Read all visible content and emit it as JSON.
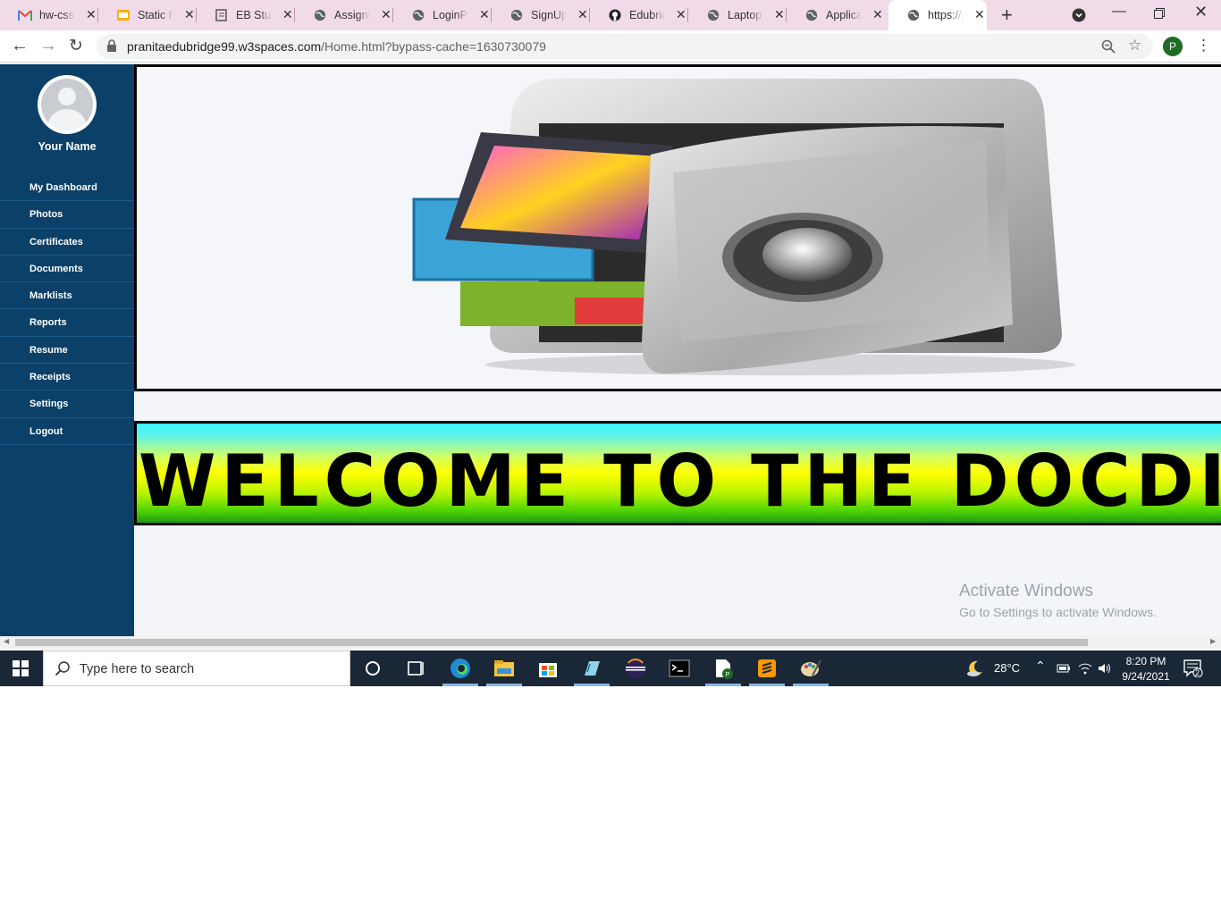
{
  "browser": {
    "tabs": [
      {
        "title": "hw-css-f",
        "icon": "gmail-icon"
      },
      {
        "title": "Static Pr",
        "icon": "slides-icon"
      },
      {
        "title": "EB Stude",
        "icon": "book-icon"
      },
      {
        "title": "Assignm",
        "icon": "globe-icon"
      },
      {
        "title": "LoginPa",
        "icon": "globe-icon"
      },
      {
        "title": "SignUpF",
        "icon": "globe-icon"
      },
      {
        "title": "Edubridg",
        "icon": "github-icon"
      },
      {
        "title": "Laptop_",
        "icon": "globe-icon"
      },
      {
        "title": "Applicat",
        "icon": "globe-icon"
      },
      {
        "title": "https://p",
        "icon": "globe-icon",
        "active": true
      }
    ],
    "url_host": "pranitaedubridge99.w3spaces.com",
    "url_path": "/Home.html?bypass-cache=1630730079",
    "profile_initial": "P"
  },
  "sidebar": {
    "user_name": "Your Name",
    "items": [
      {
        "label": "My Dashboard"
      },
      {
        "label": "Photos"
      },
      {
        "label": "Certificates"
      },
      {
        "label": "Documents"
      },
      {
        "label": "Marklists"
      },
      {
        "label": "Reports"
      },
      {
        "label": "Resume"
      },
      {
        "label": "Receipts"
      },
      {
        "label": "Settings"
      },
      {
        "label": "Logout"
      }
    ]
  },
  "main": {
    "hero_icon": "safe-vault-icon",
    "banner_text": "WELCOME TO THE DOCDIARY"
  },
  "watermark": {
    "line1": "Activate Windows",
    "line2": "Go to Settings to activate Windows."
  },
  "taskbar": {
    "search_placeholder": "Type here to search",
    "weather": "28°C",
    "time": "8:20 PM",
    "date": "9/24/2021",
    "notification_count": "2"
  },
  "colors": {
    "sidebar_bg": "#0b4068",
    "tabstrip_bg": "#f2dbe8",
    "taskbar_bg": "#1a2737"
  }
}
